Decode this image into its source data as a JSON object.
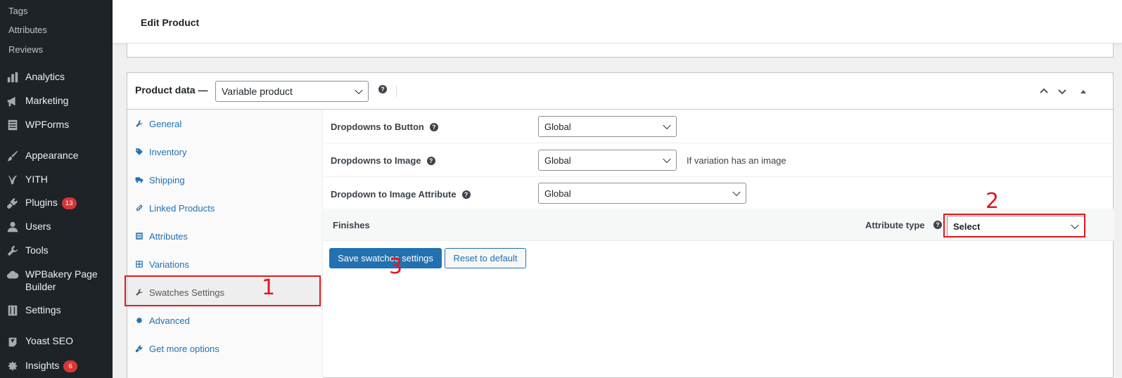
{
  "sidebar": {
    "submenu": [
      "Tags",
      "Attributes",
      "Reviews"
    ],
    "items": [
      {
        "label": "Analytics",
        "icon": "chart-bar-icon"
      },
      {
        "label": "Marketing",
        "icon": "megaphone-icon"
      },
      {
        "label": "WPForms",
        "icon": "form-icon"
      },
      {
        "label": "Appearance",
        "icon": "paintbrush-icon"
      },
      {
        "label": "YITH",
        "icon": "yith-icon"
      },
      {
        "label": "Plugins",
        "icon": "plug-icon",
        "badge": "13"
      },
      {
        "label": "Users",
        "icon": "user-icon"
      },
      {
        "label": "Tools",
        "icon": "wrench-icon"
      },
      {
        "label": "WPBakery Page Builder",
        "icon": "cloud-icon"
      },
      {
        "label": "Settings",
        "icon": "sliders-icon"
      },
      {
        "label": "Yoast SEO",
        "icon": "yoast-icon"
      },
      {
        "label": "Insights",
        "icon": "gear-icon",
        "badge": "6"
      }
    ]
  },
  "header": {
    "title": "Edit Product"
  },
  "product_data": {
    "title": "Product data —",
    "product_type": "Variable product",
    "tabs": [
      {
        "label": "General",
        "icon": "wrench-icon"
      },
      {
        "label": "Inventory",
        "icon": "tag-icon"
      },
      {
        "label": "Shipping",
        "icon": "truck-icon"
      },
      {
        "label": "Linked Products",
        "icon": "link-icon"
      },
      {
        "label": "Attributes",
        "icon": "list-icon"
      },
      {
        "label": "Variations",
        "icon": "grid-icon"
      },
      {
        "label": "Swatches Settings",
        "icon": "wrench-icon",
        "active": true
      },
      {
        "label": "Advanced",
        "icon": "gear-icon"
      },
      {
        "label": "Get more options",
        "icon": "plugin-icon"
      }
    ],
    "options": [
      {
        "label": "Dropdowns to Button",
        "value": "Global",
        "description": ""
      },
      {
        "label": "Dropdowns to Image",
        "value": "Global",
        "description": "If variation has an image"
      },
      {
        "label": "Dropdown to Image Attribute",
        "value": "Global",
        "description": ""
      }
    ],
    "attribute": {
      "name": "Finishes",
      "type_label": "Attribute type",
      "type_value": "Select"
    },
    "buttons": {
      "save": "Save swatches settings",
      "reset": "Reset to default"
    }
  },
  "annotations": [
    "1",
    "2",
    "3"
  ],
  "colors": {
    "annotation": "#e0181e",
    "primary": "#2271b1",
    "sidebar": "#1d2327"
  }
}
